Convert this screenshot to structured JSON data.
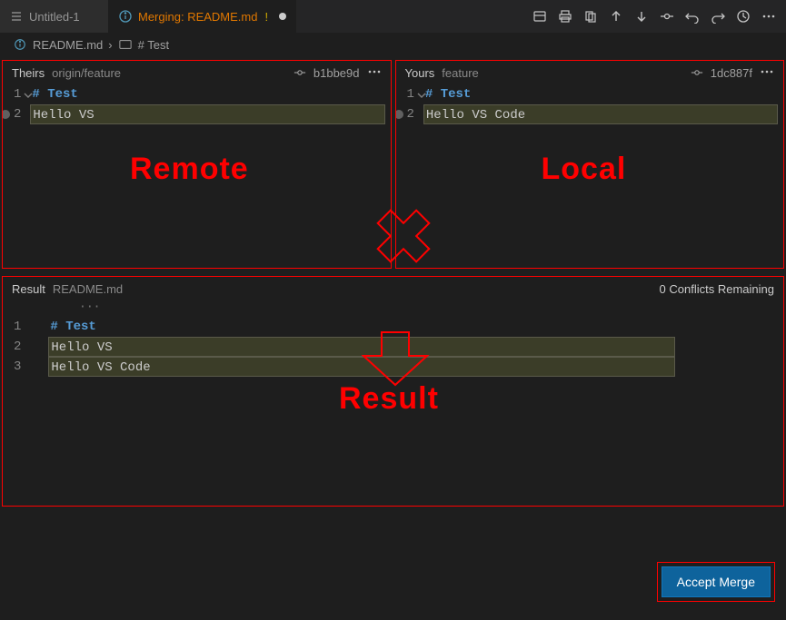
{
  "tabs": {
    "inactive": {
      "label": "Untitled-1"
    },
    "active": {
      "label": "Merging: README.md",
      "warn": "!"
    }
  },
  "breadcrumb": {
    "file": "README.md",
    "symbol": "# Test"
  },
  "theirs": {
    "title": "Theirs",
    "branch": "origin/feature",
    "commit": "b1bbe9d",
    "lines": {
      "l1": "# Test",
      "l2": "Hello VS"
    },
    "annotation": "Remote"
  },
  "yours": {
    "title": "Yours",
    "branch": "feature",
    "commit": "1dc887f",
    "lines": {
      "l1": "# Test",
      "l2": "Hello VS Code"
    },
    "annotation": "Local"
  },
  "result": {
    "title": "Result",
    "file": "README.md",
    "conflicts": "0 Conflicts Remaining",
    "lines": {
      "l1": "# Test",
      "l2": "Hello VS",
      "l3": "Hello VS Code"
    },
    "annotation": "Result"
  },
  "actions": {
    "accept": "Accept Merge"
  },
  "gutters": {
    "n1": "1",
    "n2": "2",
    "n3": "3"
  }
}
